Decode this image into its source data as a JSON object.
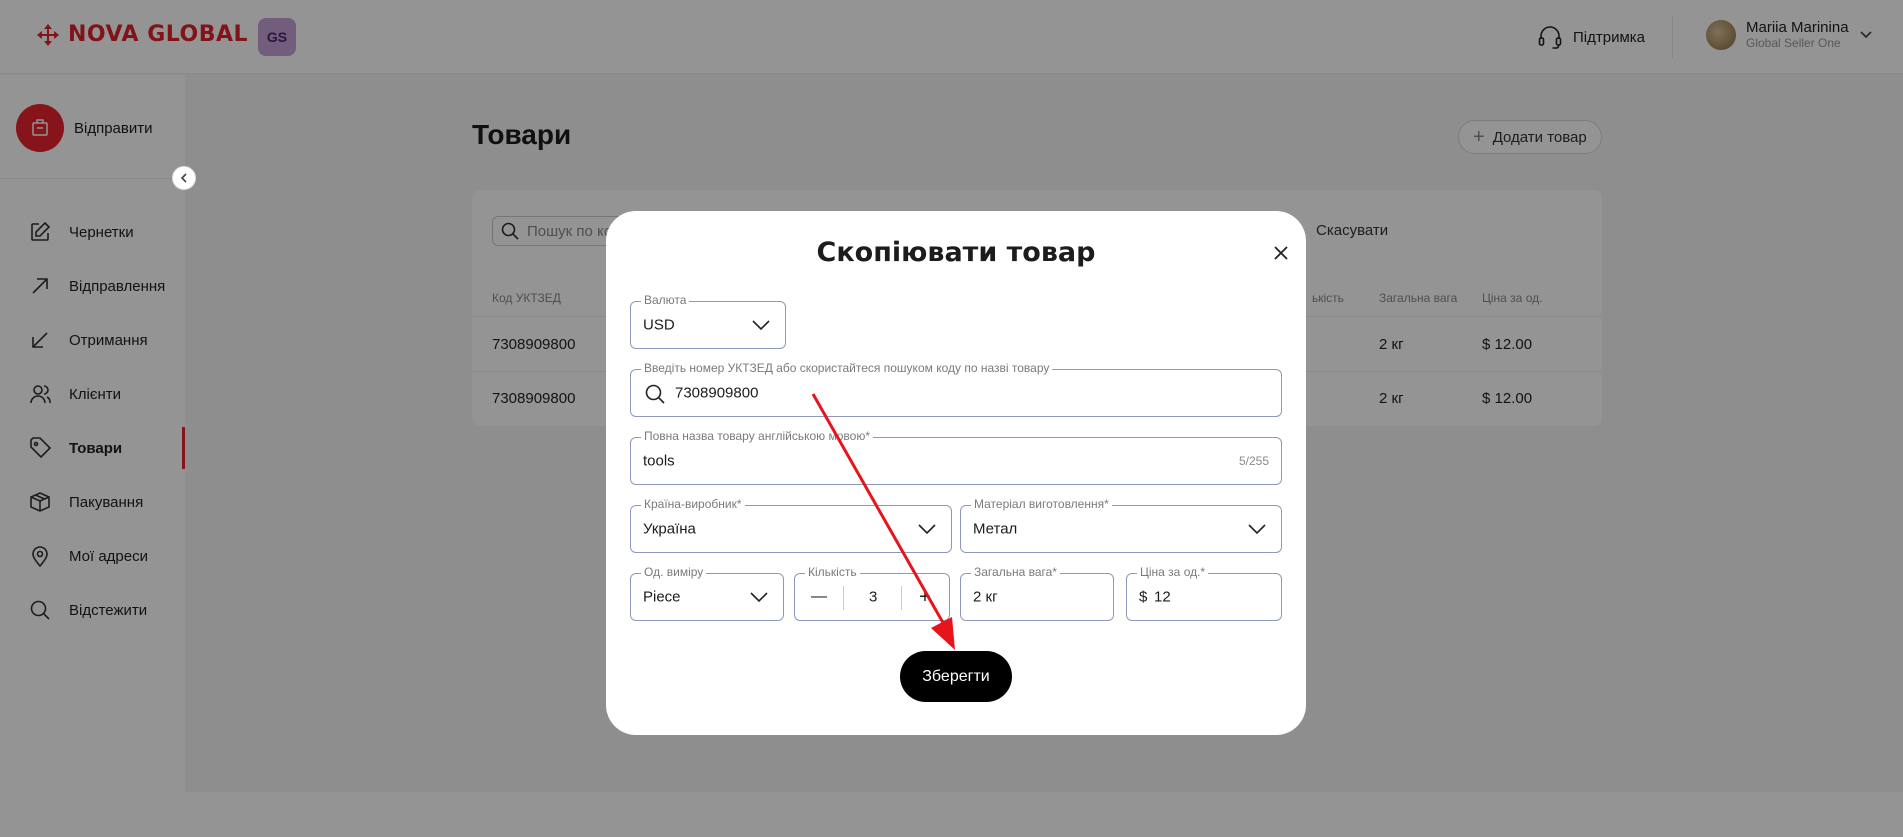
{
  "header": {
    "logo_text": "NOVA GLOBAL",
    "gs_badge": "GS",
    "support_label": "Підтримка",
    "user_name": "Mariia Marinina",
    "user_role": "Global Seller One"
  },
  "sidebar": {
    "send_label": "Відправити",
    "items": [
      {
        "label": "Чернетки",
        "icon": "edit-icon"
      },
      {
        "label": "Відправлення",
        "icon": "arrow-up-right-icon"
      },
      {
        "label": "Отримання",
        "icon": "arrow-down-left-icon"
      },
      {
        "label": "Клієнти",
        "icon": "users-icon"
      },
      {
        "label": "Товари",
        "icon": "tag-icon",
        "active": true
      },
      {
        "label": "Пакування",
        "icon": "box-icon"
      },
      {
        "label": "Мої адреси",
        "icon": "map-pin-icon"
      },
      {
        "label": "Відстежити",
        "icon": "search-icon"
      }
    ]
  },
  "main": {
    "title": "Товари",
    "add_button": "Додати товар",
    "search_placeholder": "Пошук по ко",
    "cancel_label": "Скасувати",
    "columns": {
      "code": "Код УКТЗЕД",
      "qty": "ькість",
      "weight": "Загальна вага",
      "price": "Ціна за од."
    },
    "rows": [
      {
        "code": "7308909800",
        "weight": "2 кг",
        "price": "$ 12.00"
      },
      {
        "code": "7308909800",
        "weight": "2 кг",
        "price": "$ 12.00"
      }
    ]
  },
  "modal": {
    "title": "Скопіювати товар",
    "currency": {
      "label": "Валюта",
      "value": "USD"
    },
    "code": {
      "label": "Введіть номер УКТЗЕД або скористайтеся пошуком коду по назві товару",
      "value": "7308909800"
    },
    "name": {
      "label": "Повна назва товару англійською мовою*",
      "value": "tools",
      "counter": "5/255"
    },
    "country": {
      "label": "Країна-виробник*",
      "value": "Україна"
    },
    "material": {
      "label": "Матеріал виготовлення*",
      "value": "Метал"
    },
    "unit": {
      "label": "Од. виміру",
      "value": "Piece"
    },
    "quantity": {
      "label": "Кількість",
      "value": "3",
      "minus": "—",
      "plus": "+"
    },
    "weight": {
      "label": "Загальна вага*",
      "value": "2 кг"
    },
    "price": {
      "label": "Ціна за од.*",
      "currency": "$",
      "value": "12"
    },
    "save_label": "Зберегти"
  },
  "colors": {
    "brand_red": "#e1212b",
    "field_border": "#8e98bc",
    "annotation_arrow": "#e8141c"
  }
}
